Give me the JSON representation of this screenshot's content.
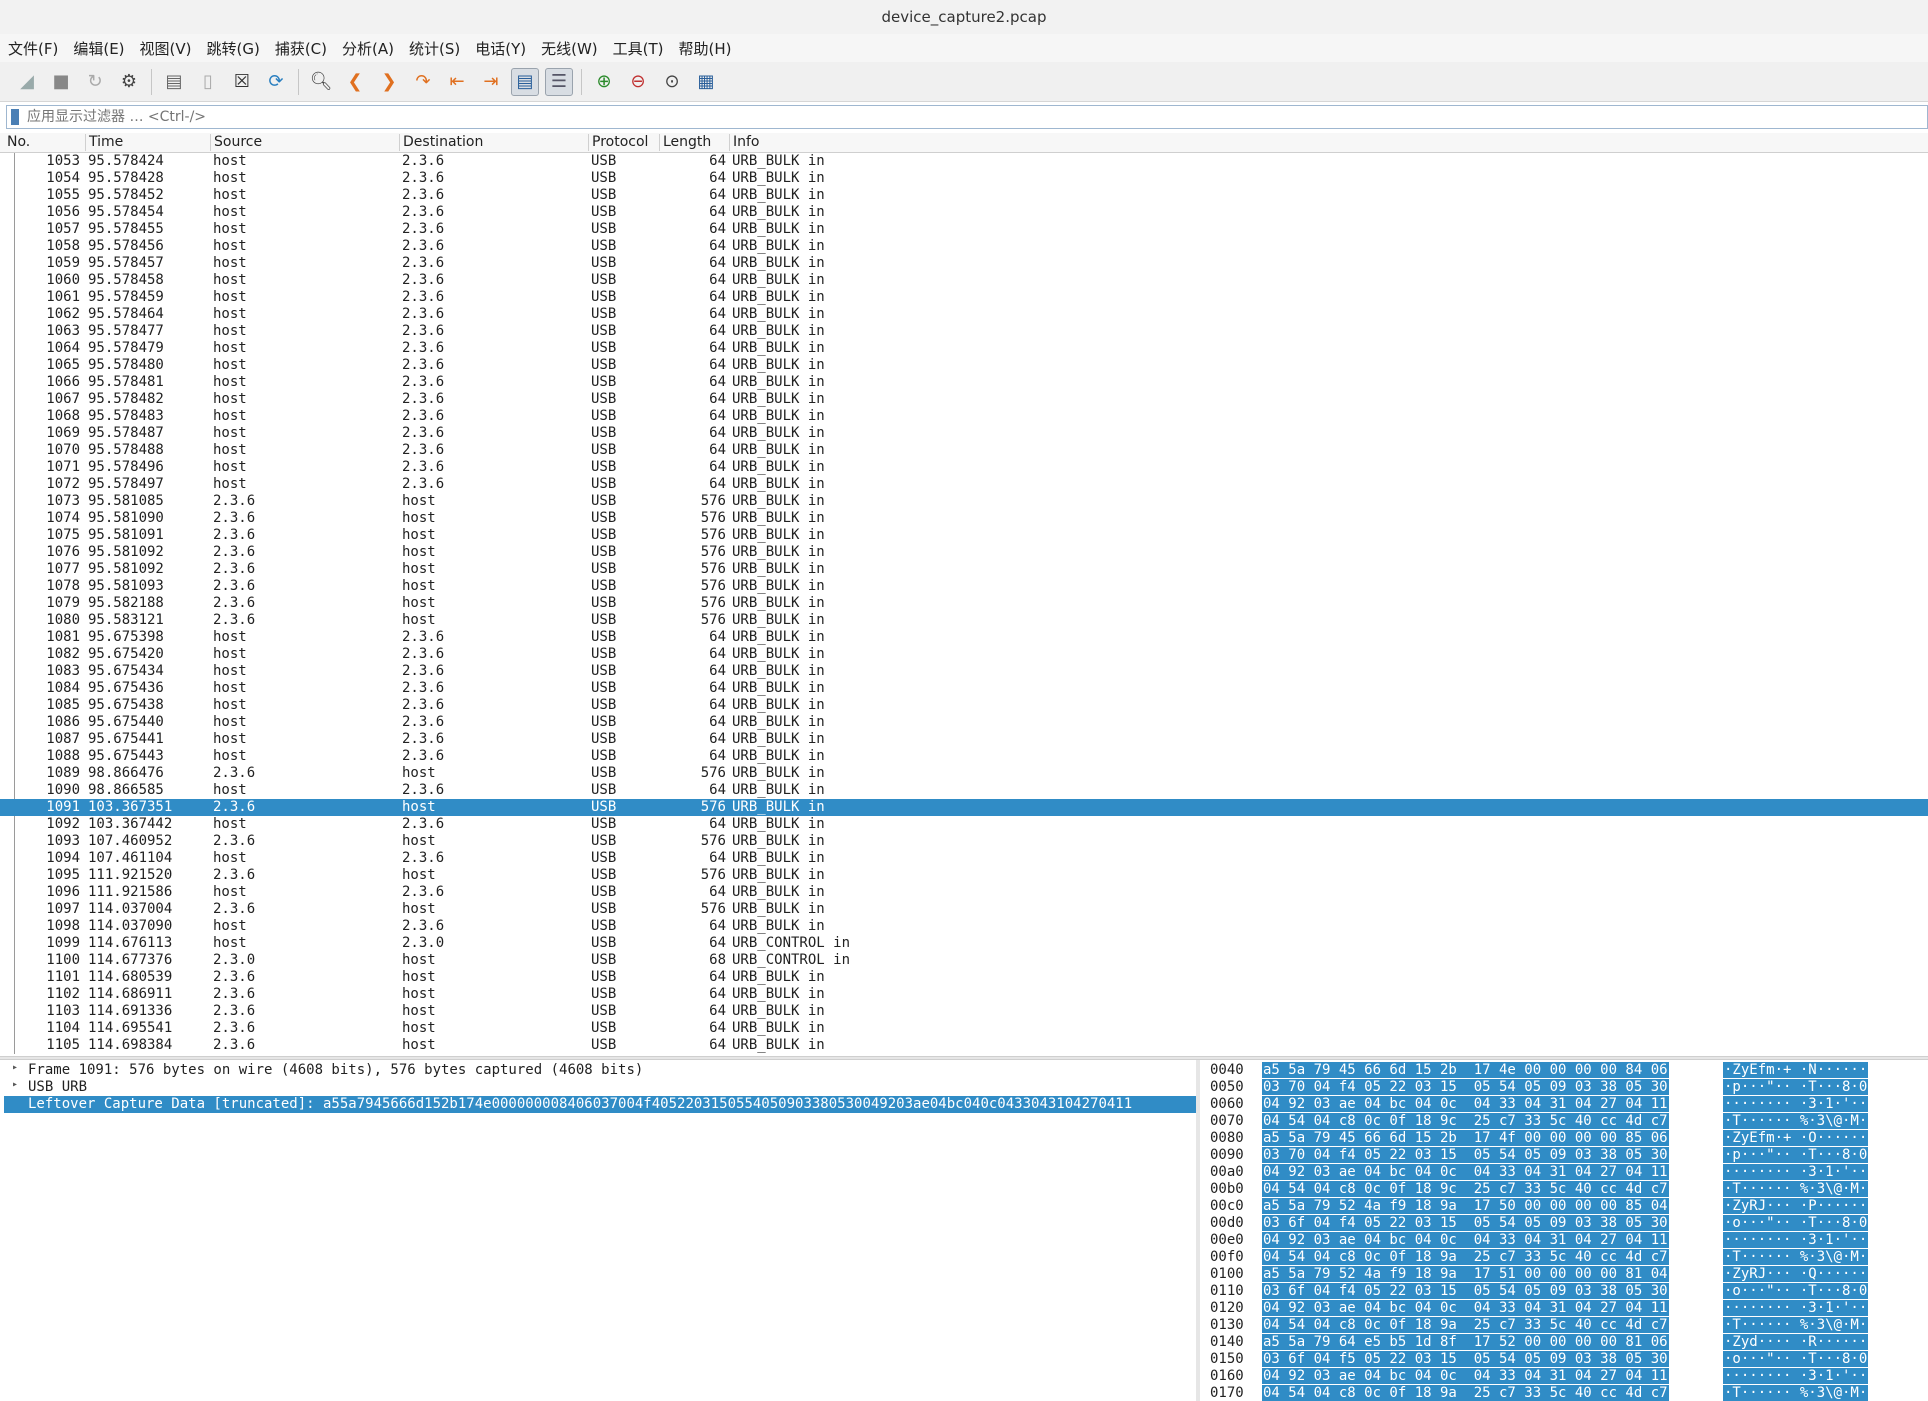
{
  "window": {
    "title": "device_capture2.pcap"
  },
  "menu": [
    "文件(F)",
    "编辑(E)",
    "视图(V)",
    "跳转(G)",
    "捕获(C)",
    "分析(A)",
    "统计(S)",
    "电话(Y)",
    "无线(W)",
    "工具(T)",
    "帮助(H)"
  ],
  "filter": {
    "placeholder": "应用显示过滤器 … <Ctrl-/>"
  },
  "columns": {
    "no": "No.",
    "time": "Time",
    "source": "Source",
    "destination": "Destination",
    "protocol": "Protocol",
    "length": "Length",
    "info": "Info"
  },
  "packets": [
    [
      "1053",
      "95.578424",
      "host",
      "2.3.6",
      "USB",
      "64",
      "URB_BULK in"
    ],
    [
      "1054",
      "95.578428",
      "host",
      "2.3.6",
      "USB",
      "64",
      "URB_BULK in"
    ],
    [
      "1055",
      "95.578452",
      "host",
      "2.3.6",
      "USB",
      "64",
      "URB_BULK in"
    ],
    [
      "1056",
      "95.578454",
      "host",
      "2.3.6",
      "USB",
      "64",
      "URB_BULK in"
    ],
    [
      "1057",
      "95.578455",
      "host",
      "2.3.6",
      "USB",
      "64",
      "URB_BULK in"
    ],
    [
      "1058",
      "95.578456",
      "host",
      "2.3.6",
      "USB",
      "64",
      "URB_BULK in"
    ],
    [
      "1059",
      "95.578457",
      "host",
      "2.3.6",
      "USB",
      "64",
      "URB_BULK in"
    ],
    [
      "1060",
      "95.578458",
      "host",
      "2.3.6",
      "USB",
      "64",
      "URB_BULK in"
    ],
    [
      "1061",
      "95.578459",
      "host",
      "2.3.6",
      "USB",
      "64",
      "URB_BULK in"
    ],
    [
      "1062",
      "95.578464",
      "host",
      "2.3.6",
      "USB",
      "64",
      "URB_BULK in"
    ],
    [
      "1063",
      "95.578477",
      "host",
      "2.3.6",
      "USB",
      "64",
      "URB_BULK in"
    ],
    [
      "1064",
      "95.578479",
      "host",
      "2.3.6",
      "USB",
      "64",
      "URB_BULK in"
    ],
    [
      "1065",
      "95.578480",
      "host",
      "2.3.6",
      "USB",
      "64",
      "URB_BULK in"
    ],
    [
      "1066",
      "95.578481",
      "host",
      "2.3.6",
      "USB",
      "64",
      "URB_BULK in"
    ],
    [
      "1067",
      "95.578482",
      "host",
      "2.3.6",
      "USB",
      "64",
      "URB_BULK in"
    ],
    [
      "1068",
      "95.578483",
      "host",
      "2.3.6",
      "USB",
      "64",
      "URB_BULK in"
    ],
    [
      "1069",
      "95.578487",
      "host",
      "2.3.6",
      "USB",
      "64",
      "URB_BULK in"
    ],
    [
      "1070",
      "95.578488",
      "host",
      "2.3.6",
      "USB",
      "64",
      "URB_BULK in"
    ],
    [
      "1071",
      "95.578496",
      "host",
      "2.3.6",
      "USB",
      "64",
      "URB_BULK in"
    ],
    [
      "1072",
      "95.578497",
      "host",
      "2.3.6",
      "USB",
      "64",
      "URB_BULK in"
    ],
    [
      "1073",
      "95.581085",
      "2.3.6",
      "host",
      "USB",
      "576",
      "URB_BULK in"
    ],
    [
      "1074",
      "95.581090",
      "2.3.6",
      "host",
      "USB",
      "576",
      "URB_BULK in"
    ],
    [
      "1075",
      "95.581091",
      "2.3.6",
      "host",
      "USB",
      "576",
      "URB_BULK in"
    ],
    [
      "1076",
      "95.581092",
      "2.3.6",
      "host",
      "USB",
      "576",
      "URB_BULK in"
    ],
    [
      "1077",
      "95.581092",
      "2.3.6",
      "host",
      "USB",
      "576",
      "URB_BULK in"
    ],
    [
      "1078",
      "95.581093",
      "2.3.6",
      "host",
      "USB",
      "576",
      "URB_BULK in"
    ],
    [
      "1079",
      "95.582188",
      "2.3.6",
      "host",
      "USB",
      "576",
      "URB_BULK in"
    ],
    [
      "1080",
      "95.583121",
      "2.3.6",
      "host",
      "USB",
      "576",
      "URB_BULK in"
    ],
    [
      "1081",
      "95.675398",
      "host",
      "2.3.6",
      "USB",
      "64",
      "URB_BULK in"
    ],
    [
      "1082",
      "95.675420",
      "host",
      "2.3.6",
      "USB",
      "64",
      "URB_BULK in"
    ],
    [
      "1083",
      "95.675434",
      "host",
      "2.3.6",
      "USB",
      "64",
      "URB_BULK in"
    ],
    [
      "1084",
      "95.675436",
      "host",
      "2.3.6",
      "USB",
      "64",
      "URB_BULK in"
    ],
    [
      "1085",
      "95.675438",
      "host",
      "2.3.6",
      "USB",
      "64",
      "URB_BULK in"
    ],
    [
      "1086",
      "95.675440",
      "host",
      "2.3.6",
      "USB",
      "64",
      "URB_BULK in"
    ],
    [
      "1087",
      "95.675441",
      "host",
      "2.3.6",
      "USB",
      "64",
      "URB_BULK in"
    ],
    [
      "1088",
      "95.675443",
      "host",
      "2.3.6",
      "USB",
      "64",
      "URB_BULK in"
    ],
    [
      "1089",
      "98.866476",
      "2.3.6",
      "host",
      "USB",
      "576",
      "URB_BULK in"
    ],
    [
      "1090",
      "98.866585",
      "host",
      "2.3.6",
      "USB",
      "64",
      "URB_BULK in"
    ],
    [
      "1091",
      "103.367351",
      "2.3.6",
      "host",
      "USB",
      "576",
      "URB_BULK in"
    ],
    [
      "1092",
      "103.367442",
      "host",
      "2.3.6",
      "USB",
      "64",
      "URB_BULK in"
    ],
    [
      "1093",
      "107.460952",
      "2.3.6",
      "host",
      "USB",
      "576",
      "URB_BULK in"
    ],
    [
      "1094",
      "107.461104",
      "host",
      "2.3.6",
      "USB",
      "64",
      "URB_BULK in"
    ],
    [
      "1095",
      "111.921520",
      "2.3.6",
      "host",
      "USB",
      "576",
      "URB_BULK in"
    ],
    [
      "1096",
      "111.921586",
      "host",
      "2.3.6",
      "USB",
      "64",
      "URB_BULK in"
    ],
    [
      "1097",
      "114.037004",
      "2.3.6",
      "host",
      "USB",
      "576",
      "URB_BULK in"
    ],
    [
      "1098",
      "114.037090",
      "host",
      "2.3.6",
      "USB",
      "64",
      "URB_BULK in"
    ],
    [
      "1099",
      "114.676113",
      "host",
      "2.3.0",
      "USB",
      "64",
      "URB_CONTROL in"
    ],
    [
      "1100",
      "114.677376",
      "2.3.0",
      "host",
      "USB",
      "68",
      "URB_CONTROL in"
    ],
    [
      "1101",
      "114.680539",
      "2.3.6",
      "host",
      "USB",
      "64",
      "URB_BULK in"
    ],
    [
      "1102",
      "114.686911",
      "2.3.6",
      "host",
      "USB",
      "64",
      "URB_BULK in"
    ],
    [
      "1103",
      "114.691336",
      "2.3.6",
      "host",
      "USB",
      "64",
      "URB_BULK in"
    ],
    [
      "1104",
      "114.695541",
      "2.3.6",
      "host",
      "USB",
      "64",
      "URB_BULK in"
    ],
    [
      "1105",
      "114.698384",
      "2.3.6",
      "host",
      "USB",
      "64",
      "URB_BULK in"
    ]
  ],
  "selected_packet": "1091",
  "details": [
    {
      "text": "Frame 1091: 576 bytes on wire (4608 bits), 576 bytes captured (4608 bits)",
      "expandable": true
    },
    {
      "text": "USB URB",
      "expandable": true
    },
    {
      "text": "Leftover Capture Data [truncated]: a55a7945666d152b174e000000008406037004f405220315055405090338053004920​3ae04bc040c0433043104270411",
      "expandable": false,
      "selected": true
    }
  ],
  "bytes": [
    [
      "0040",
      "a5 5a 79 45 66 6d 15 2b  17 4e 00 00 00 00 84 06",
      "·ZyEfm·+ ·N······"
    ],
    [
      "0050",
      "03 70 04 f4 05 22 03 15  05 54 05 09 03 38 05 30",
      "·p···\"·· ·T···8·0"
    ],
    [
      "0060",
      "04 92 03 ae 04 bc 04 0c  04 33 04 31 04 27 04 11",
      "········ ·3·1·'··"
    ],
    [
      "0070",
      "04 54 04 c8 0c 0f 18 9c  25 c7 33 5c 40 cc 4d c7",
      "·T······ %·3\\@·M·"
    ],
    [
      "0080",
      "a5 5a 79 45 66 6d 15 2b  17 4f 00 00 00 00 85 06",
      "·ZyEfm·+ ·O······"
    ],
    [
      "0090",
      "03 70 04 f4 05 22 03 15  05 54 05 09 03 38 05 30",
      "·p···\"·· ·T···8·0"
    ],
    [
      "00a0",
      "04 92 03 ae 04 bc 04 0c  04 33 04 31 04 27 04 11",
      "········ ·3·1·'··"
    ],
    [
      "00b0",
      "04 54 04 c8 0c 0f 18 9c  25 c7 33 5c 40 cc 4d c7",
      "·T······ %·3\\@·M·"
    ],
    [
      "00c0",
      "a5 5a 79 52 4a f9 18 9a  17 50 00 00 00 00 85 04",
      "·ZyRJ··· ·P······"
    ],
    [
      "00d0",
      "03 6f 04 f4 05 22 03 15  05 54 05 09 03 38 05 30",
      "·o···\"·· ·T···8·0"
    ],
    [
      "00e0",
      "04 92 03 ae 04 bc 04 0c  04 33 04 31 04 27 04 11",
      "········ ·3·1·'··"
    ],
    [
      "00f0",
      "04 54 04 c8 0c 0f 18 9a  25 c7 33 5c 40 cc 4d c7",
      "·T······ %·3\\@·M·"
    ],
    [
      "0100",
      "a5 5a 79 52 4a f9 18 9a  17 51 00 00 00 00 81 04",
      "·ZyRJ··· ·Q······"
    ],
    [
      "0110",
      "03 6f 04 f4 05 22 03 15  05 54 05 09 03 38 05 30",
      "·o···\"·· ·T···8·0"
    ],
    [
      "0120",
      "04 92 03 ae 04 bc 04 0c  04 33 04 31 04 27 04 11",
      "········ ·3·1·'··"
    ],
    [
      "0130",
      "04 54 04 c8 0c 0f 18 9a  25 c7 33 5c 40 cc 4d c7",
      "·T······ %·3\\@·M·"
    ],
    [
      "0140",
      "a5 5a 79 64 e5 b5 1d 8f  17 52 00 00 00 00 81 06",
      "·Zyd···· ·R······"
    ],
    [
      "0150",
      "03 6f 04 f5 05 22 03 15  05 54 05 09 03 38 05 30",
      "·o···\"·· ·T···8·0"
    ],
    [
      "0160",
      "04 92 03 ae 04 bc 04 0c  04 33 04 31 04 27 04 11",
      "········ ·3·1·'··"
    ],
    [
      "0170",
      "04 54 04 c8 0c 0f 18 9a  25 c7 33 5c 40 cc 4d c7",
      "·T······ %·3\\@·M·"
    ]
  ],
  "colors": {
    "selection": "#308cc6"
  }
}
